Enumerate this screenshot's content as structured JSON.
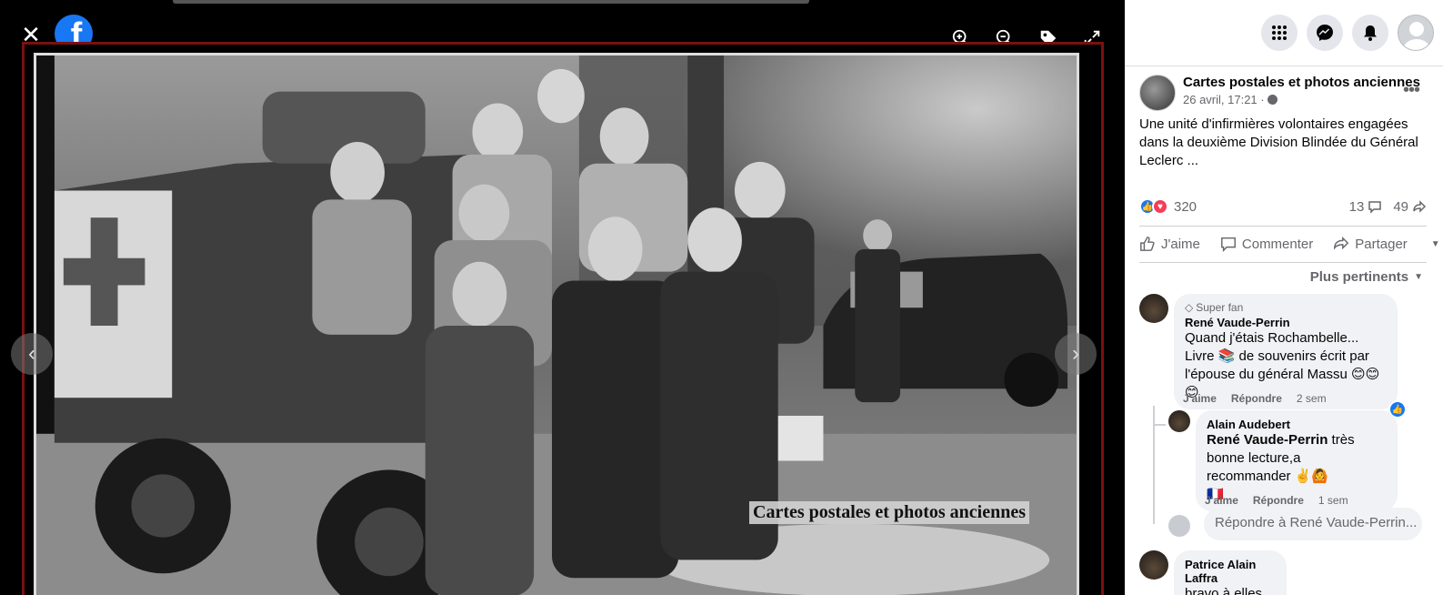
{
  "viewer": {
    "close_icon": "close-icon",
    "logo_letter": "f",
    "tools": [
      "zoom-in-icon",
      "zoom-out-icon",
      "tag-icon",
      "fullscreen-icon"
    ],
    "watermark": "Cartes postales et photos anciennes",
    "prev_icon": "chevron-left-icon",
    "next_icon": "chevron-right-icon",
    "prev_glyph": "‹",
    "next_glyph": "›"
  },
  "header": {
    "buttons": [
      "menu-icon",
      "messenger-icon",
      "notifications-icon"
    ]
  },
  "post": {
    "page_name": "Cartes postales et photos anciennes",
    "date": "26 avril, 17:21 ·",
    "more": "•••",
    "text": "Une unité d'infirmières volontaires engagées dans la deuxième Division Blindée du Général Leclerc ...",
    "reaction_count": "320",
    "comments_count": "13",
    "shares_count": "49"
  },
  "actions": {
    "like": "J'aime",
    "comment": "Commenter",
    "share": "Partager"
  },
  "sort_label": "Plus pertinents",
  "comments": [
    {
      "badge": "Super fan",
      "author": "René Vaude-Perrin",
      "text": "Quand j'étais Rochambelle... Livre 📚 de souvenirs écrit par l'épouse du général Massu 😊😊😊",
      "like": "J'aime",
      "reply": "Répondre",
      "time": "2 sem"
    },
    {
      "author": "Alain Audebert",
      "mention": "René Vaude-Perrin",
      "text": " très bonne lecture,a recommander ✌️🙆",
      "flag": "🇫🇷",
      "like": "J'aime",
      "reply": "Répondre",
      "time": "1 sem"
    },
    {
      "author": "Patrice Alain Laffra",
      "text": "bravo à elles"
    }
  ],
  "reply_placeholder": "Répondre à René Vaude-Perrin..."
}
